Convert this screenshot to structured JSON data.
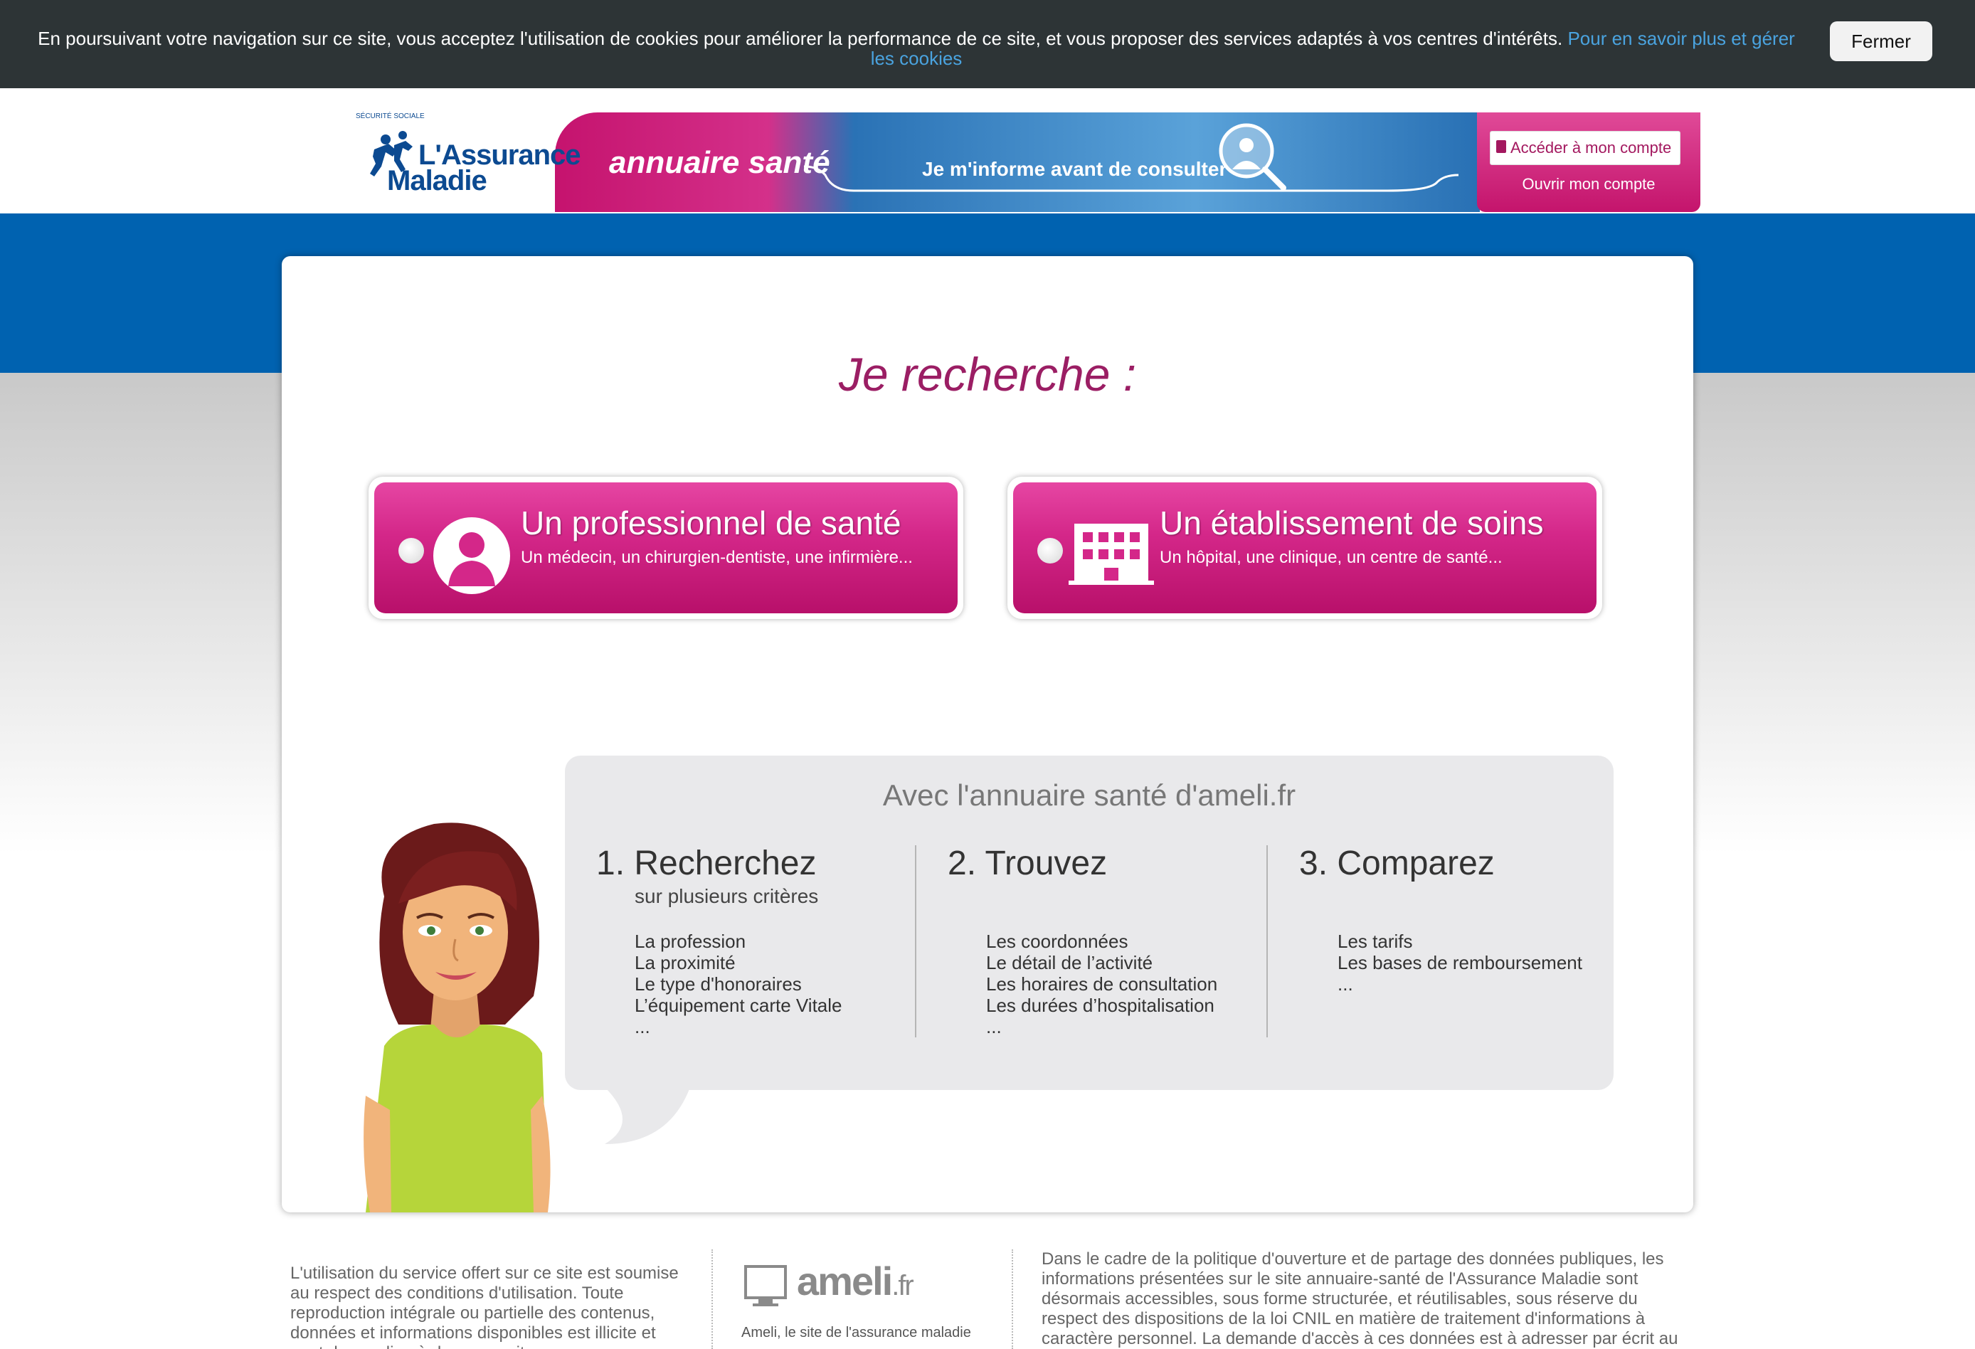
{
  "cookie_banner": {
    "text": "En poursuivant votre navigation sur ce site, vous acceptez l'utilisation de cookies pour améliorer la performance de ce site, et vous proposer des services adaptés à vos centres d'intérêts.",
    "link_text": "Pour en savoir plus et gérer les cookies",
    "close_label": "Fermer"
  },
  "header": {
    "logo_small": "SÉCURITÉ SOCIALE",
    "logo_line1": "L'Assurance",
    "logo_line2": "Maladie",
    "site_title": "annuaire santé",
    "tagline": "Je m'informe avant de consulter",
    "account_button": "Accéder à mon compte",
    "open_account": "Ouvrir mon compte"
  },
  "main": {
    "heading": "Je recherche :",
    "choices": [
      {
        "title": "Un professionnel de santé",
        "subtitle": "Un médecin, un chirurgien-dentiste, une infirmière..."
      },
      {
        "title": "Un établissement de soins",
        "subtitle": "Un hôpital, une clinique, un centre de santé..."
      }
    ]
  },
  "info": {
    "title": "Avec l'annuaire santé d'ameli.fr",
    "steps": [
      {
        "title": "1. Recherchez",
        "subtitle": "sur plusieurs critères",
        "items": [
          "La profession",
          "La proximité",
          "Le type d'honoraires",
          "L’équipement carte Vitale",
          "..."
        ]
      },
      {
        "title": "2. Trouvez",
        "subtitle": "",
        "items": [
          "Les coordonnées",
          "Le détail de l’activité",
          "Les horaires de consultation",
          "Les durées d’hospitalisation",
          "..."
        ]
      },
      {
        "title": "3. Comparez",
        "subtitle": "",
        "items": [
          "Les tarifs",
          "Les bases de remboursement",
          "..."
        ]
      }
    ]
  },
  "footer": {
    "left_text": "L'utilisation du service offert sur ce site est soumise au respect des conditions d'utilisation. Toute reproduction intégrale ou partielle des contenus, données et informations disponibles est illicite et peut donner lieu à des poursuites.",
    "ameli_logo": "ameli",
    "ameli_logo_suffix": ".fr",
    "ameli_caption": "Ameli, le site de l'assurance maladie",
    "right_text": "Dans le cadre de la politique d'ouverture et de partage des données publiques, les informations présentées sur le site annuaire-santé de l'Assurance Maladie sont désormais accessibles, sous forme structurée, et réutilisables, sous réserve du respect des dispositions de la loi CNIL en matière de traitement d'informations à caractère personnel. La demande d'accès à ces données est à adresser par écrit au"
  },
  "colors": {
    "brand_pink": "#c4146c",
    "brand_blue": "#0062b0",
    "heading_purple": "#9b1e64",
    "cookie_bg": "#2d3436",
    "link_blue": "#4aa3df"
  }
}
